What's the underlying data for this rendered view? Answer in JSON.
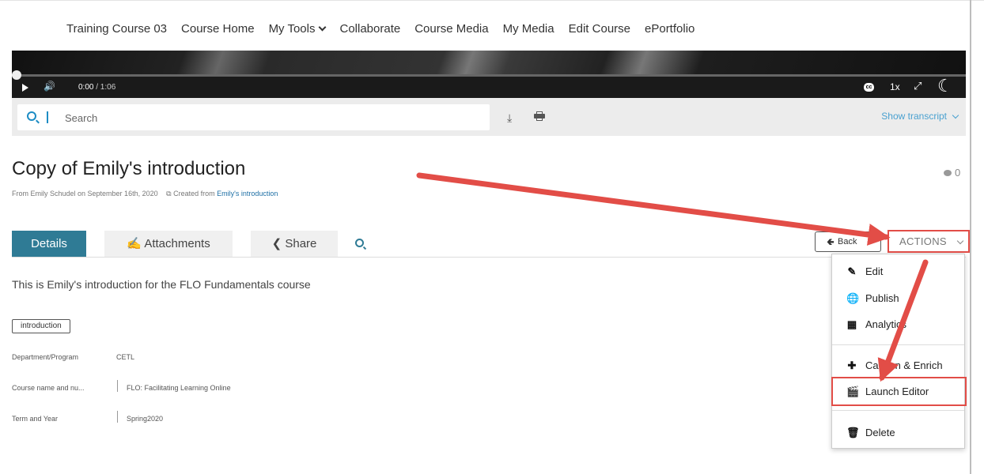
{
  "nav": {
    "items": [
      "Training Course 03",
      "Course Home",
      "My Tools",
      "Collaborate",
      "Course Media",
      "My Media",
      "Edit Course",
      "ePortfolio"
    ]
  },
  "player": {
    "current_time": "0:00",
    "duration": "/ 1:06",
    "speed": "1x",
    "progress_fraction": 0
  },
  "search": {
    "placeholder": "Search",
    "show_transcript": "Show transcript"
  },
  "media": {
    "title": "Copy of Emily's introduction",
    "meta_prefix": "From Emily Schudel on September 16th, 2020",
    "created_from_label": "Created from",
    "created_from_link": "Emily's introduction",
    "comment_count": "0",
    "description": "This is Emily's introduction for the FLO Fundamentals course",
    "tag": "introduction"
  },
  "tabs": {
    "details": "Details",
    "attachments": "Attachments",
    "share": "Share"
  },
  "buttons": {
    "back": "Back",
    "actions": "ACTIONS"
  },
  "actions_menu": {
    "edit": "Edit",
    "publish": "Publish",
    "analytics": "Analytics",
    "caption": "Caption & Enrich",
    "launch_editor": "Launch Editor",
    "delete": "Delete"
  },
  "properties": [
    {
      "label": "Department/Program",
      "value": "CETL"
    },
    {
      "label": "Course name and nu...",
      "value": "FLO: Facilitating Learning Online"
    },
    {
      "label": "Term and Year",
      "value": "Spring2020"
    }
  ],
  "colors": {
    "accent": "#2f7b95",
    "link": "#1d6fa5",
    "annotation_red": "#e24d47"
  },
  "icons": {
    "search": "search-icon",
    "download": "download-icon",
    "print": "print-icon",
    "comment": "comment-icon",
    "paperclip": "paperclip-icon",
    "share": "share-icon",
    "back": "arrow-left-icon",
    "edit": "pencil-icon",
    "publish": "globe-icon",
    "analytics": "bar-chart-icon",
    "caption": "plus-icon",
    "launch_editor": "clapperboard-icon",
    "delete": "trash-icon"
  }
}
